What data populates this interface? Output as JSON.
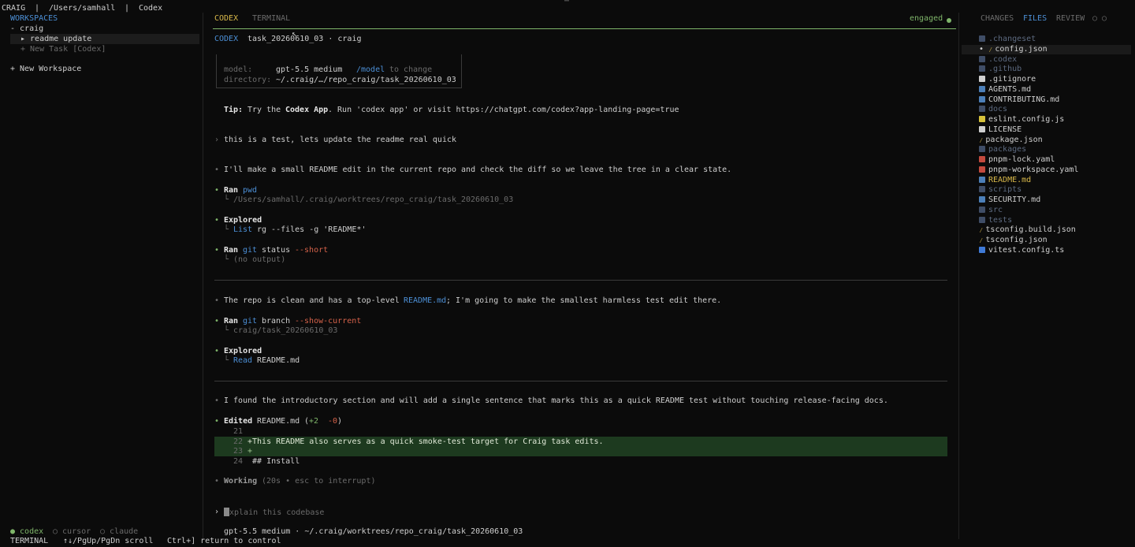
{
  "topbar": {
    "app": "CRAIG",
    "sep1": "|",
    "path": "/Users/samhall",
    "sep2": "|",
    "title": "Codex",
    "handle": "⋯"
  },
  "sidebar": {
    "heading": "WORKSPACES",
    "workspace": "- craig",
    "task_active": "▸ readme update",
    "task_new": "+ New Task [Codex]",
    "new_workspace": "+ New Workspace",
    "agents": [
      "● codex",
      "○ cursor",
      "○ claude"
    ]
  },
  "center": {
    "tabs": [
      "CODEX",
      "TERMINAL"
    ],
    "status": "engaged",
    "crumb_app": "CODEX",
    "crumb_task": "task_20260610_03 · craig",
    "info": {
      "model_label": "model:",
      "model_value": "gpt-5.5 medium",
      "model_cmd": "/model",
      "model_hint": "to change",
      "dir_label": "directory:",
      "dir_value": "~/.craig/…/repo_craig/task_20260610_03"
    },
    "tip_label": "Tip:",
    "tip_pre": "Try the",
    "tip_app": "Codex App",
    "tip_post": ". Run 'codex app' or visit https://chatgpt.com/codex?app-landing-page=true",
    "user_prompt": "this is a test, lets update the readme real quick",
    "msg1": "I'll make a small README edit in the current repo and check the diff so we leave the tree in a clear state.",
    "ran1_label": "Ran",
    "ran1_cmd": "pwd",
    "ran1_out": "/Users/samhall/.craig/worktrees/repo_craig/task_20260610_03",
    "explored1_label": "Explored",
    "explored1_verb": "List",
    "explored1_cmd": "rg --files -g 'README*'",
    "ran2_label": "Ran",
    "ran2_cmd_a": "git",
    "ran2_cmd_b": "status",
    "ran2_cmd_c": "--short",
    "ran2_out": "(no output)",
    "msg2_pre": "The repo is clean and has a top-level",
    "msg2_link": "README.md",
    "msg2_post": "; I'm going to make the smallest harmless test edit there.",
    "ran3_label": "Ran",
    "ran3_cmd_a": "git",
    "ran3_cmd_b": "branch",
    "ran3_cmd_c": "--show-current",
    "ran3_out": "craig/task_20260610_03",
    "explored2_label": "Explored",
    "explored2_verb": "Read",
    "explored2_file": "README.md",
    "msg3": "I found the introductory section and will add a single sentence that marks this as a quick README test without touching release-facing docs.",
    "edited_label": "Edited",
    "edited_file": "README.md",
    "edited_open": "(",
    "edited_add": "+2",
    "edited_del": "-0",
    "edited_close": ")",
    "diff": [
      {
        "num": "21",
        "text": ""
      },
      {
        "num": "22",
        "text": "+This README also serves as a quick smoke-test target for Craig task edits."
      },
      {
        "num": "23",
        "text": "+"
      },
      {
        "num": "24",
        "text": " ## Install"
      }
    ],
    "working_label": "Working",
    "working_detail": "(20s • esc to interrupt)",
    "input_rest": "xplain this codebase",
    "footer": "gpt-5.5 medium · ~/.craig/worktrees/repo_craig/task_20260610_03"
  },
  "right": {
    "tabs": [
      "CHANGES",
      "FILES",
      "REVIEW"
    ],
    "icons": "○ ○",
    "files": [
      {
        "name": ".changeset",
        "kind": "folder",
        "indent": 0
      },
      {
        "name": "config.json",
        "kind": "json",
        "indent": 1
      },
      {
        "name": ".codex",
        "kind": "folder",
        "indent": 0
      },
      {
        "name": ".github",
        "kind": "folder",
        "indent": 0
      },
      {
        "name": ".gitignore",
        "kind": "file",
        "indent": 0
      },
      {
        "name": "AGENTS.md",
        "kind": "md",
        "indent": 0
      },
      {
        "name": "CONTRIBUTING.md",
        "kind": "md",
        "indent": 0
      },
      {
        "name": "docs",
        "kind": "folder",
        "indent": 0
      },
      {
        "name": "eslint.config.js",
        "kind": "js",
        "indent": 0
      },
      {
        "name": "LICENSE",
        "kind": "file",
        "indent": 0
      },
      {
        "name": "package.json",
        "kind": "json",
        "indent": 0
      },
      {
        "name": "packages",
        "kind": "folder",
        "indent": 0
      },
      {
        "name": "pnpm-lock.yaml",
        "kind": "yaml",
        "indent": 0
      },
      {
        "name": "pnpm-workspace.yaml",
        "kind": "yaml",
        "indent": 0
      },
      {
        "name": "README.md",
        "kind": "md-mod",
        "indent": 0
      },
      {
        "name": "scripts",
        "kind": "folder",
        "indent": 0
      },
      {
        "name": "SECURITY.md",
        "kind": "md",
        "indent": 0
      },
      {
        "name": "src",
        "kind": "folder",
        "indent": 0
      },
      {
        "name": "tests",
        "kind": "folder",
        "indent": 0
      },
      {
        "name": "tsconfig.build.json",
        "kind": "json",
        "indent": 0
      },
      {
        "name": "tsconfig.json",
        "kind": "json",
        "indent": 0
      },
      {
        "name": "vitest.config.ts",
        "kind": "ts",
        "indent": 0
      }
    ]
  },
  "statusbar": {
    "mode": "TERMINAL",
    "scroll_hint": "↑↓/PgUp/PgDn scroll",
    "return_hint": "Ctrl+] return to control"
  }
}
